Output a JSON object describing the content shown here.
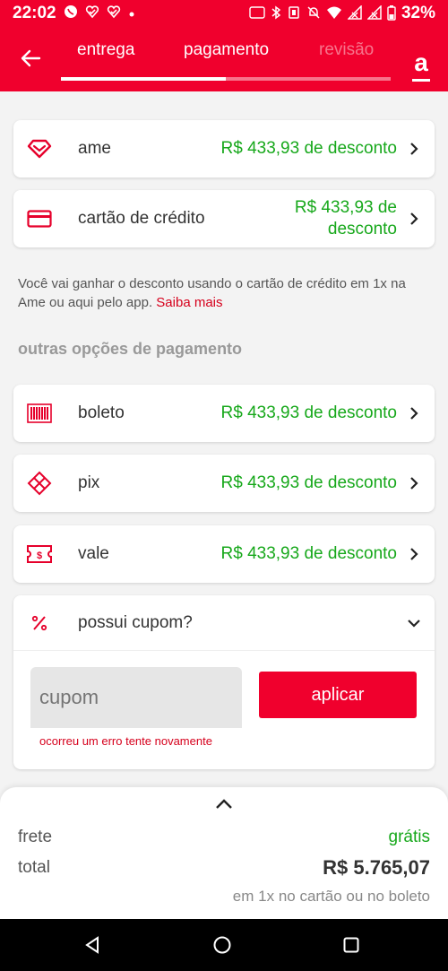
{
  "status": {
    "time": "22:02",
    "battery": "32%",
    "icons": [
      "whatsapp-icon",
      "check-heart-icon",
      "check-heart-icon",
      "dot-icon",
      "hd-icon",
      "bluetooth-icon",
      "vibrate-icon",
      "mute-icon",
      "wifi-icon",
      "signal-icon",
      "signal-icon",
      "battery-icon"
    ]
  },
  "header": {
    "tabs": [
      {
        "label": "entrega"
      },
      {
        "label": "pagamento"
      },
      {
        "label": "revisão"
      }
    ],
    "progress": 0.5,
    "logo": "a"
  },
  "payment_methods": [
    {
      "name": "ame",
      "discount": "R$ 433,93 de desconto",
      "icon": "heart-icon"
    },
    {
      "name": "cartão de crédito",
      "discount_line1": "R$ 433,93 de",
      "discount_line2": "desconto",
      "icon": "credit-card-icon"
    }
  ],
  "info": {
    "text": "Você vai ganhar o desconto usando o cartão de crédito em 1x na Ame ou aqui pelo app.",
    "link": "Saiba mais"
  },
  "other_section_title": "outras opções de pagamento",
  "other_methods": [
    {
      "name": "boleto",
      "discount": "R$ 433,93 de desconto",
      "icon": "barcode-icon"
    },
    {
      "name": "pix",
      "discount": "R$ 433,93 de desconto",
      "icon": "pix-icon"
    },
    {
      "name": "vale",
      "discount": "R$ 433,93 de desconto",
      "icon": "voucher-icon"
    }
  ],
  "coupon": {
    "title": "possui cupom?",
    "placeholder": "cupom",
    "button": "aplicar",
    "error": "ocorreu um erro tente novamente"
  },
  "summary": {
    "frete_label": "frete",
    "frete_value": "grátis",
    "total_label": "total",
    "total_value": "R$ 5.765,07",
    "subtitle": "em 1x no cartão ou no boleto"
  },
  "colors": {
    "brand": "#f0002d",
    "discount": "#17a81b",
    "link": "#d6001c"
  }
}
